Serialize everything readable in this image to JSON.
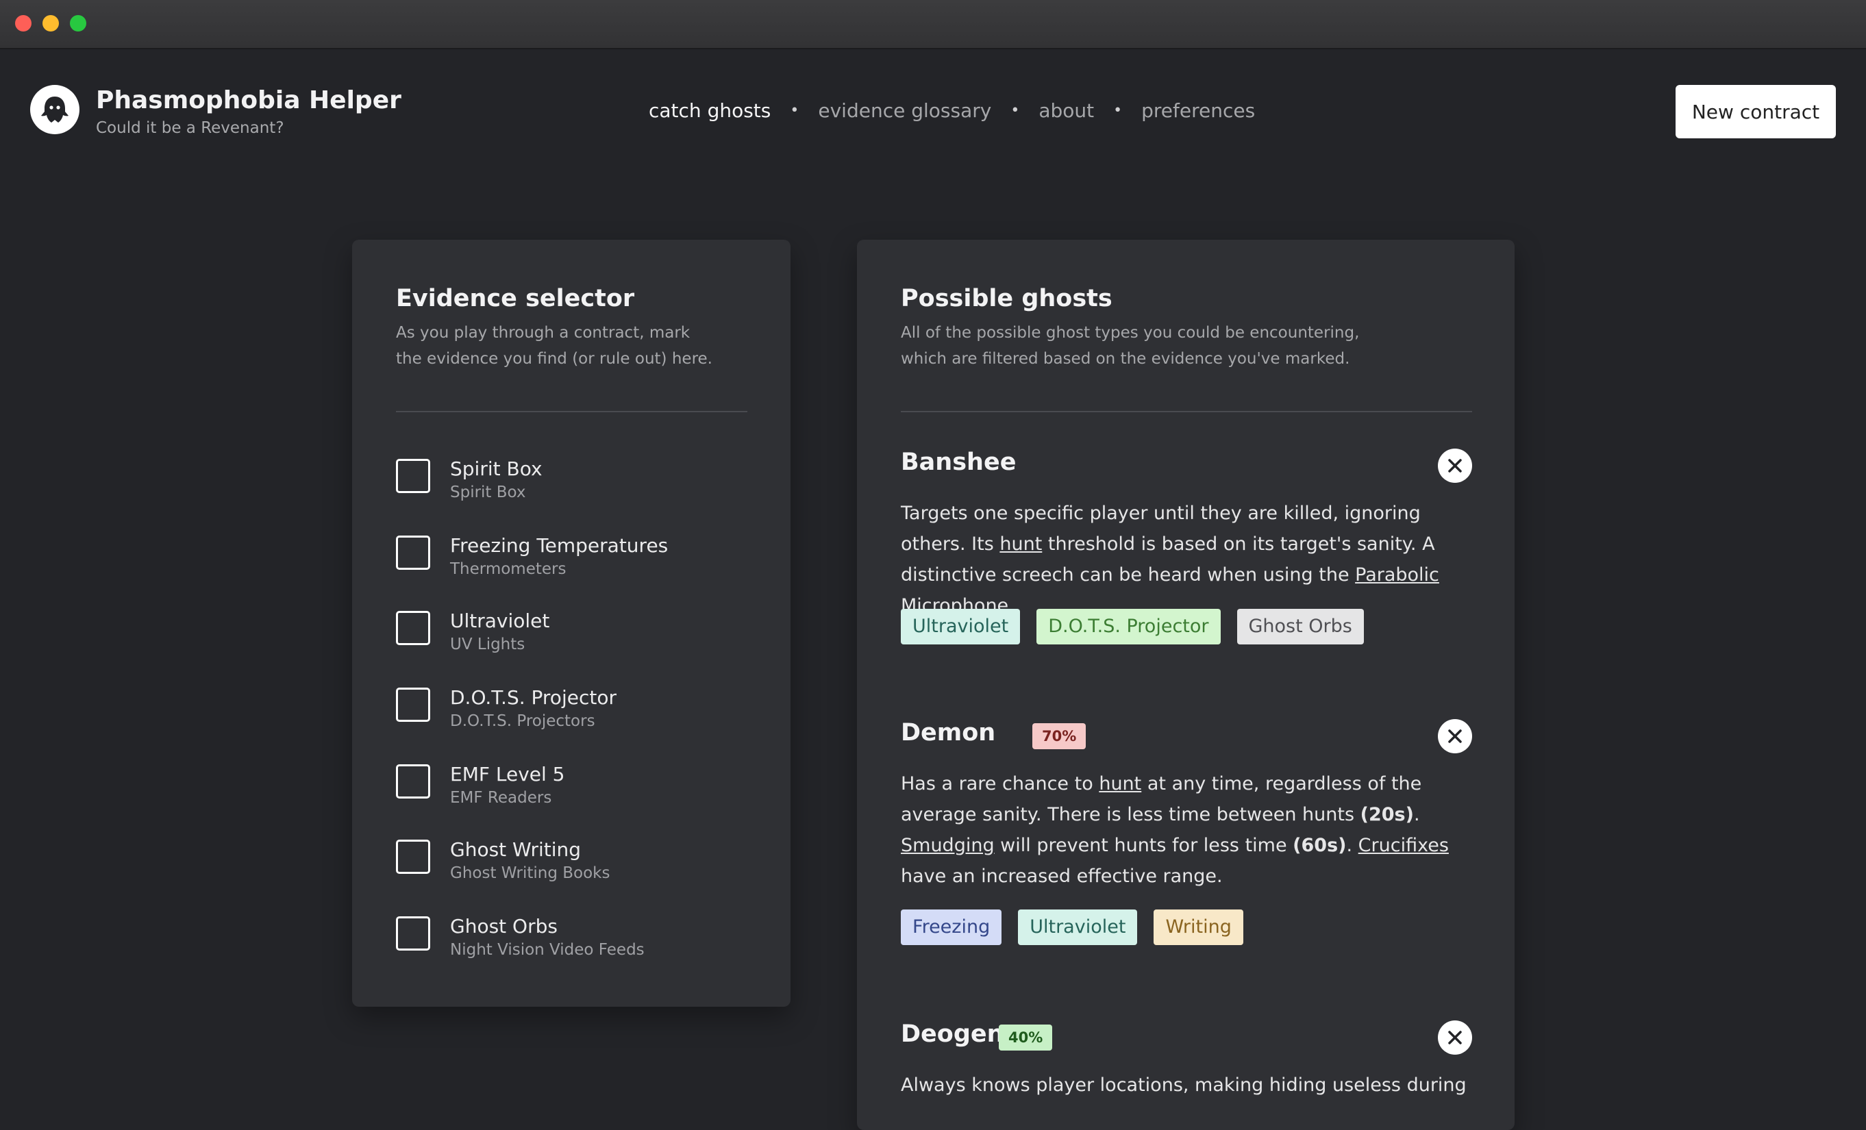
{
  "app": {
    "title": "Phasmophobia Helper",
    "subtitle": "Could it be a Revenant?",
    "logo_icon": "ghost-icon"
  },
  "nav": {
    "items": [
      {
        "label": "catch ghosts",
        "active": true
      },
      {
        "label": "evidence glossary",
        "active": false
      },
      {
        "label": "about",
        "active": false
      },
      {
        "label": "preferences",
        "active": false
      }
    ],
    "separator": "•"
  },
  "header": {
    "new_contract_label": "New contract"
  },
  "evidence_selector": {
    "title": "Evidence selector",
    "desc_line1": "As you play through a contract, mark",
    "desc_line2": "the evidence you find (or rule out) here.",
    "items": [
      {
        "label": "Spirit Box",
        "equipment": "Spirit Box",
        "checked": false
      },
      {
        "label": "Freezing Temperatures",
        "equipment": "Thermometers",
        "checked": false
      },
      {
        "label": "Ultraviolet",
        "equipment": "UV Lights",
        "checked": false
      },
      {
        "label": "D.O.T.S. Projector",
        "equipment": "D.O.T.S. Projectors",
        "checked": false
      },
      {
        "label": "EMF Level 5",
        "equipment": "EMF Readers",
        "checked": false
      },
      {
        "label": "Ghost Writing",
        "equipment": "Ghost Writing Books",
        "checked": false
      },
      {
        "label": "Ghost Orbs",
        "equipment": "Night Vision Video Feeds",
        "checked": false
      }
    ]
  },
  "possible_ghosts": {
    "title": "Possible ghosts",
    "desc_line1": "All of the possible ghost types you could be encountering,",
    "desc_line2": "which are filtered based on the evidence you've marked.",
    "ghosts": [
      {
        "name": "Banshee",
        "percent": "",
        "desc": {
          "t1": "Targets one specific player until they are killed, ignoring others. Its ",
          "l1": "hunt",
          "t2": " threshold is based on its target's sanity. A distinctive screech can be heard when using the ",
          "l2": "Parabolic Microphone",
          "t3": "."
        },
        "tags": [
          "Ultraviolet",
          "D.O.T.S. Projector",
          "Ghost Orbs"
        ]
      },
      {
        "name": "Demon",
        "percent": "70%",
        "desc": {
          "t1": "Has a rare chance to ",
          "l1": "hunt",
          "t2": " at any time, regardless of the average sanity. There is less time between hunts ",
          "b1": "(20s)",
          "t3": ". ",
          "l2": "Smudging",
          "t4": " will prevent hunts for less time ",
          "b2": "(60s)",
          "t5": ". ",
          "l3": "Crucifixes",
          "t6": " have an increased effective range."
        },
        "tags": [
          "Freezing",
          "Ultraviolet",
          "Writing"
        ]
      },
      {
        "name": "Deogen",
        "percent": "40%",
        "desc": {
          "t1": "Always knows player locations, making hiding useless during"
        },
        "tags": []
      }
    ]
  },
  "colors": {
    "background": "#232428",
    "panel": "#2f3034",
    "tag_ultraviolet": "#d5f2ea",
    "tag_dots": "#d3f5ce",
    "tag_ghost_orbs": "#e5e5e6",
    "tag_freezing": "#d4dcf7",
    "tag_writing": "#f8e8c8",
    "badge_red": "#f6c9c8",
    "badge_green": "#c7f0c6"
  }
}
